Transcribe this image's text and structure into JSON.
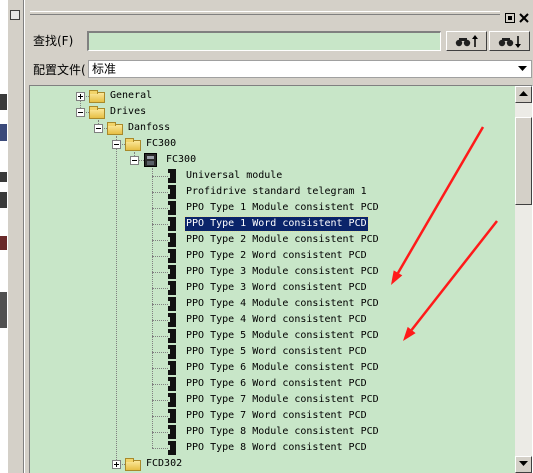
{
  "panel": {
    "pin_icon": "pin-icon",
    "close_icon": "close-icon"
  },
  "find": {
    "label": "查找(F)",
    "value": "",
    "find_up_icon": "binoculars-up-icon",
    "find_down_icon": "binoculars-down-icon"
  },
  "profile": {
    "label": "配置文件(",
    "value": "标准",
    "dropdown_icon": "chevron-down-icon"
  },
  "tree": {
    "items": [
      {
        "label": "General",
        "level": 0,
        "icon": "folder-icon",
        "expander": true,
        "expanded": false
      },
      {
        "label": "Drives",
        "level": 0,
        "icon": "folder-icon",
        "expander": true,
        "expanded": true
      },
      {
        "label": "Danfoss",
        "level": 1,
        "icon": "folder-icon",
        "expander": true,
        "expanded": true
      },
      {
        "label": "FC300",
        "level": 2,
        "icon": "folder-icon",
        "expander": true,
        "expanded": true
      },
      {
        "label": "FC300",
        "level": 3,
        "icon": "device-icon",
        "expander": true,
        "expanded": true
      },
      {
        "label": "Universal module",
        "level": 4,
        "icon": "module-icon"
      },
      {
        "label": "Profidrive standard telegram 1",
        "level": 4,
        "icon": "module-icon"
      },
      {
        "label": "PPO Type 1 Module consistent PCD",
        "level": 4,
        "icon": "module-icon"
      },
      {
        "label": "PPO Type 1 Word consistent PCD",
        "level": 4,
        "icon": "module-icon",
        "selected": true
      },
      {
        "label": "PPO Type 2 Module consistent PCD",
        "level": 4,
        "icon": "module-icon"
      },
      {
        "label": "PPO Type 2 Word consistent PCD",
        "level": 4,
        "icon": "module-icon"
      },
      {
        "label": "PPO Type 3 Module consistent PCD",
        "level": 4,
        "icon": "module-icon"
      },
      {
        "label": "PPO Type 3 Word consistent PCD",
        "level": 4,
        "icon": "module-icon"
      },
      {
        "label": "PPO Type 4 Module consistent PCD",
        "level": 4,
        "icon": "module-icon"
      },
      {
        "label": "PPO Type 4 Word consistent PCD",
        "level": 4,
        "icon": "module-icon"
      },
      {
        "label": "PPO Type 5 Module consistent PCD",
        "level": 4,
        "icon": "module-icon"
      },
      {
        "label": "PPO Type 5 Word consistent PCD",
        "level": 4,
        "icon": "module-icon"
      },
      {
        "label": "PPO Type 6 Module consistent PCD",
        "level": 4,
        "icon": "module-icon"
      },
      {
        "label": "PPO Type 6 Word consistent PCD",
        "level": 4,
        "icon": "module-icon"
      },
      {
        "label": "PPO Type 7 Module consistent PCD",
        "level": 4,
        "icon": "module-icon"
      },
      {
        "label": "PPO Type 7 Word consistent PCD",
        "level": 4,
        "icon": "module-icon"
      },
      {
        "label": "PPO Type 8 Module consistent PCD",
        "level": 4,
        "icon": "module-icon"
      },
      {
        "label": "PPO Type 8 Word consistent PCD",
        "level": 4,
        "icon": "module-icon"
      },
      {
        "label": "FCD302",
        "level": 2,
        "icon": "folder-icon",
        "expander": true,
        "expanded": false
      }
    ]
  },
  "scroll": {
    "position": 0.04,
    "visible": 0.25,
    "up_icon": "scroll-up-icon",
    "down_icon": "scroll-down-icon"
  },
  "colors": {
    "panel": "#d4d0c8",
    "tree_background": "#c8e6c8",
    "input_background": "#c8e6c8",
    "selection": "#0a246a",
    "annotation_arrow": "#ff1a1a"
  }
}
